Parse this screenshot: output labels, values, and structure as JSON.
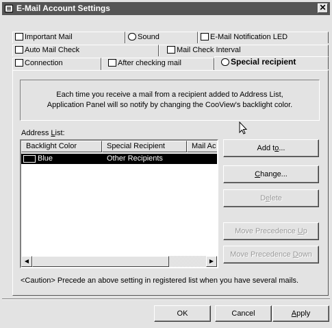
{
  "window": {
    "title": "E-Mail Account Settings",
    "close_label": "✕"
  },
  "tabs": {
    "row1": [
      {
        "label": "Important Mail",
        "icon": "important-mail-icon"
      },
      {
        "label": "Sound",
        "icon": "sound-icon"
      },
      {
        "label": "E-Mail Notification LED",
        "icon": "led-icon"
      }
    ],
    "row2": [
      {
        "label": "Auto Mail Check",
        "icon": "auto-check-icon"
      },
      {
        "label": "Mail Check Interval",
        "icon": "interval-icon"
      }
    ],
    "row3": [
      {
        "label": "Connection",
        "icon": "connection-icon"
      },
      {
        "label": "After checking mail",
        "icon": "after-check-icon"
      },
      {
        "label": "Special recipient",
        "icon": "special-recipient-icon",
        "active": true
      }
    ]
  },
  "info": {
    "line1": "Each time you receive a mail from a recipient added to Address List,",
    "line2": "Application Panel will so notify by changing the CooView's backlight color."
  },
  "address_list": {
    "label_pre": "Address ",
    "label_accel": "L",
    "label_post": "ist:",
    "columns": [
      "Backlight Color",
      "Special Recipient",
      "Mail Ac"
    ],
    "rows": [
      {
        "color": "Blue",
        "recipient": "Other Recipients",
        "selected": true
      }
    ]
  },
  "buttons": {
    "add": {
      "pre": "Add t",
      "accel": "o",
      "post": "..."
    },
    "change": {
      "pre": "",
      "accel": "C",
      "post": "hange..."
    },
    "delete": {
      "pre": "D",
      "accel": "e",
      "post": "lete"
    },
    "move_up": {
      "pre": "Move Precedence ",
      "accel": "U",
      "post": "p"
    },
    "move_down": {
      "pre": "Move Precedence ",
      "accel": "D",
      "post": "own"
    }
  },
  "caution": "<Caution> Precede an above setting in registered list when you have several mails.",
  "footer": {
    "ok": "OK",
    "cancel": "Cancel",
    "apply_pre": "",
    "apply_accel": "A",
    "apply_post": "pply"
  }
}
